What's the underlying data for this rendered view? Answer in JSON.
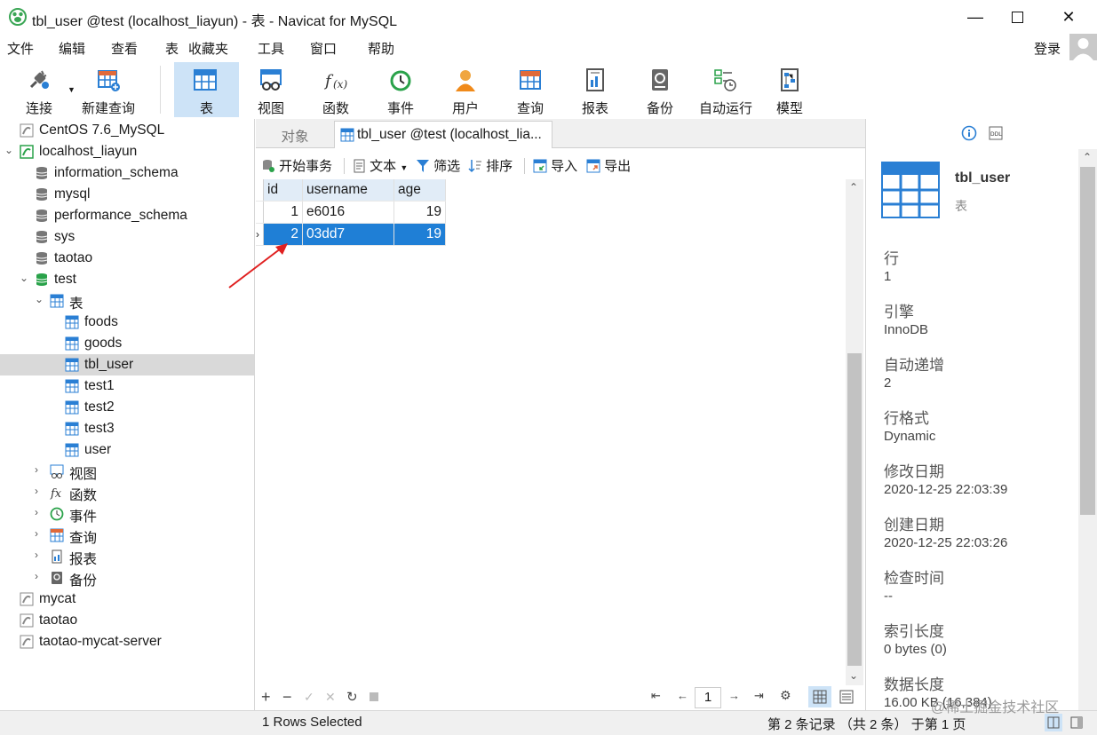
{
  "window": {
    "title": "tbl_user @test (localhost_liayun) - 表 - Navicat for MySQL"
  },
  "menu": [
    "文件",
    "编辑",
    "查看",
    "表",
    "收藏夹",
    "工具",
    "窗口",
    "帮助"
  ],
  "login_label": "登录",
  "toolbar": {
    "connect": "连接",
    "new_query": "新建查询",
    "items": [
      "表",
      "视图",
      "函数",
      "事件",
      "用户",
      "查询",
      "报表",
      "备份",
      "自动运行",
      "模型"
    ]
  },
  "tree": {
    "conn1": "CentOS 7.6_MySQL",
    "conn2": "localhost_liayun",
    "dbs": [
      "information_schema",
      "mysql",
      "performance_schema",
      "sys",
      "taotao",
      "test"
    ],
    "tables_group": "表",
    "tables": [
      "foods",
      "goods",
      "tbl_user",
      "test1",
      "test2",
      "test3",
      "user"
    ],
    "groups": [
      "视图",
      "函数",
      "事件",
      "查询",
      "报表",
      "备份"
    ],
    "conns_other": [
      "mycat",
      "taotao",
      "taotao-mycat-server"
    ]
  },
  "tabs": {
    "objects": "对象",
    "current": "tbl_user @test (localhost_lia..."
  },
  "grid_toolbar": {
    "begin_tx": "开始事务",
    "text": "文本",
    "filter": "筛选",
    "sort": "排序",
    "import": "导入",
    "export": "导出"
  },
  "grid": {
    "columns": [
      "id",
      "username",
      "age"
    ],
    "rows": [
      [
        "1",
        "e6016",
        "19"
      ],
      [
        "2",
        "03dd7",
        "19"
      ]
    ],
    "selected_row": 2
  },
  "pager": {
    "page": "1"
  },
  "status": {
    "left": "1 Rows Selected",
    "right": "第 2 条记录 （共 2 条） 于第 1 页"
  },
  "info": {
    "name": "tbl_user",
    "type": "表",
    "fields": [
      {
        "label": "行",
        "value": "1"
      },
      {
        "label": "引擎",
        "value": "InnoDB"
      },
      {
        "label": "自动递增",
        "value": "2"
      },
      {
        "label": "行格式",
        "value": "Dynamic"
      },
      {
        "label": "修改日期",
        "value": "2020-12-25 22:03:39"
      },
      {
        "label": "创建日期",
        "value": "2020-12-25 22:03:26"
      },
      {
        "label": "检查时间",
        "value": "--"
      },
      {
        "label": "索引长度",
        "value": "0 bytes (0)"
      },
      {
        "label": "数据长度",
        "value": "16.00 KB (16,384)"
      }
    ]
  },
  "watermark": "@稀土掘金技术社区",
  "colors": {
    "accent": "#1f7fd6",
    "selection_tree": "#d9d9d9",
    "toolbar_active": "#cde3f7",
    "arrow": "#e02020"
  }
}
